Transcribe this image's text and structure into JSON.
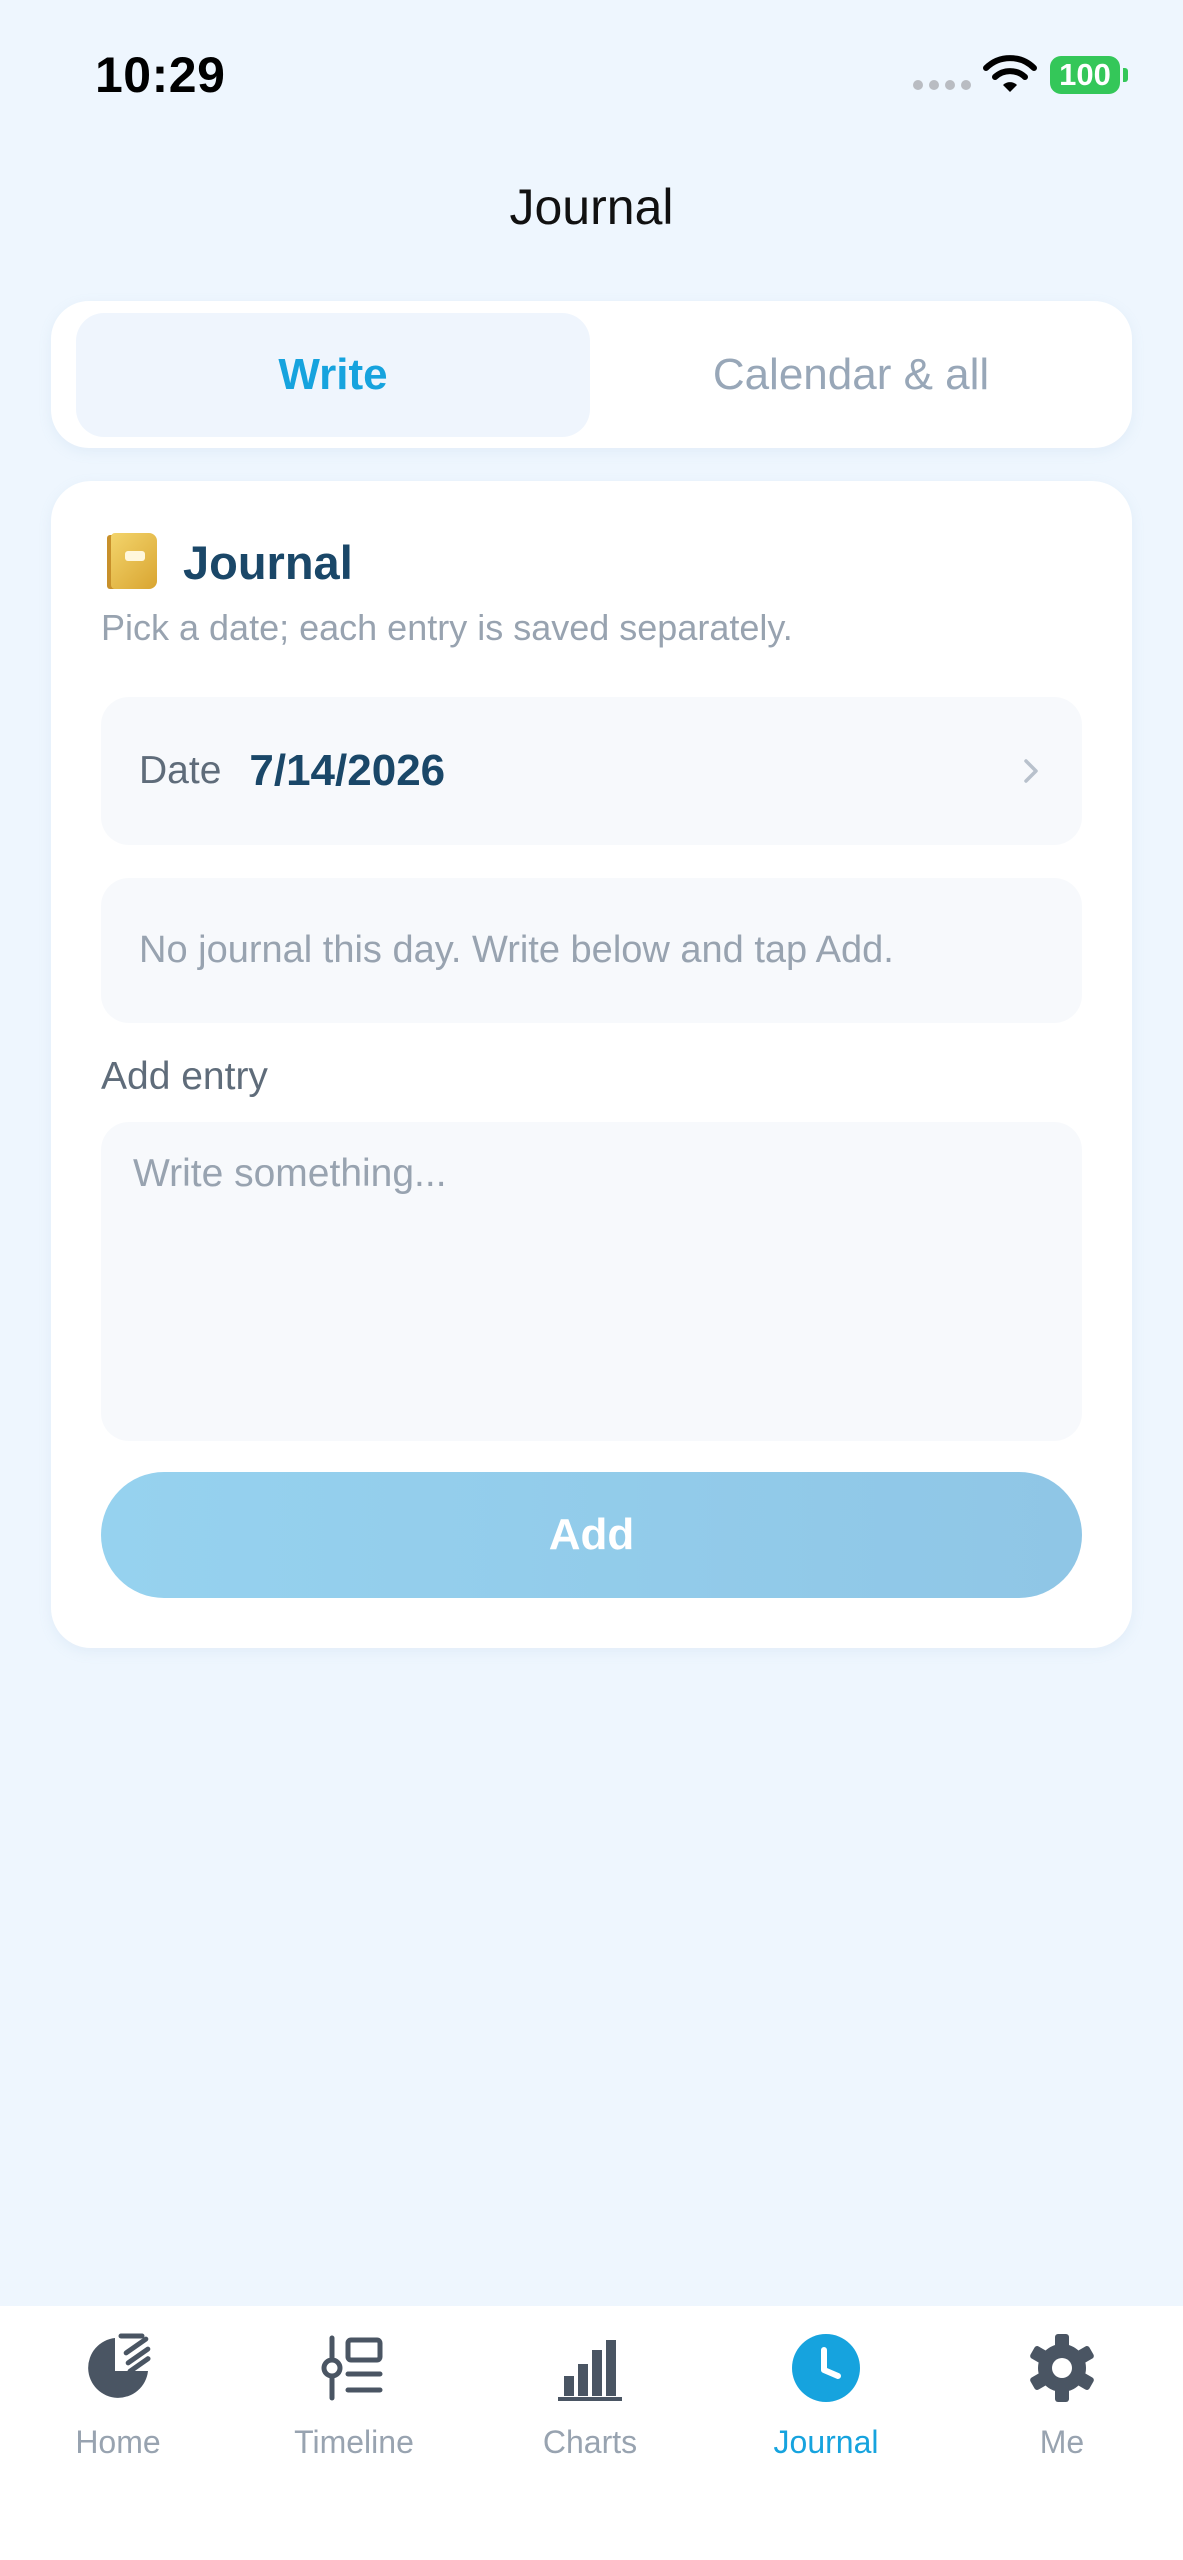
{
  "status_bar": {
    "time": "10:29",
    "battery": "100"
  },
  "header": {
    "title": "Journal"
  },
  "segments": {
    "write": "Write",
    "calendar": "Calendar & all"
  },
  "card": {
    "title": "Journal",
    "subtitle": "Pick a date; each entry is saved separately.",
    "date_label": "Date",
    "date_value": "7/14/2026",
    "empty_message": "No journal this day. Write below and tap Add.",
    "add_entry_label": "Add entry",
    "entry_placeholder": "Write something...",
    "entry_value": "",
    "add_button": "Add"
  },
  "tabs": [
    {
      "label": "Home",
      "icon": "home-pie-icon",
      "active": false
    },
    {
      "label": "Timeline",
      "icon": "timeline-icon",
      "active": false
    },
    {
      "label": "Charts",
      "icon": "bar-chart-icon",
      "active": false
    },
    {
      "label": "Journal",
      "icon": "clock-icon",
      "active": true
    },
    {
      "label": "Me",
      "icon": "gear-icon",
      "active": false
    }
  ],
  "colors": {
    "accent": "#16a3de",
    "background": "#eef6fe",
    "heading": "#1a4768",
    "muted": "#98a3b0",
    "battery": "#34c759"
  }
}
